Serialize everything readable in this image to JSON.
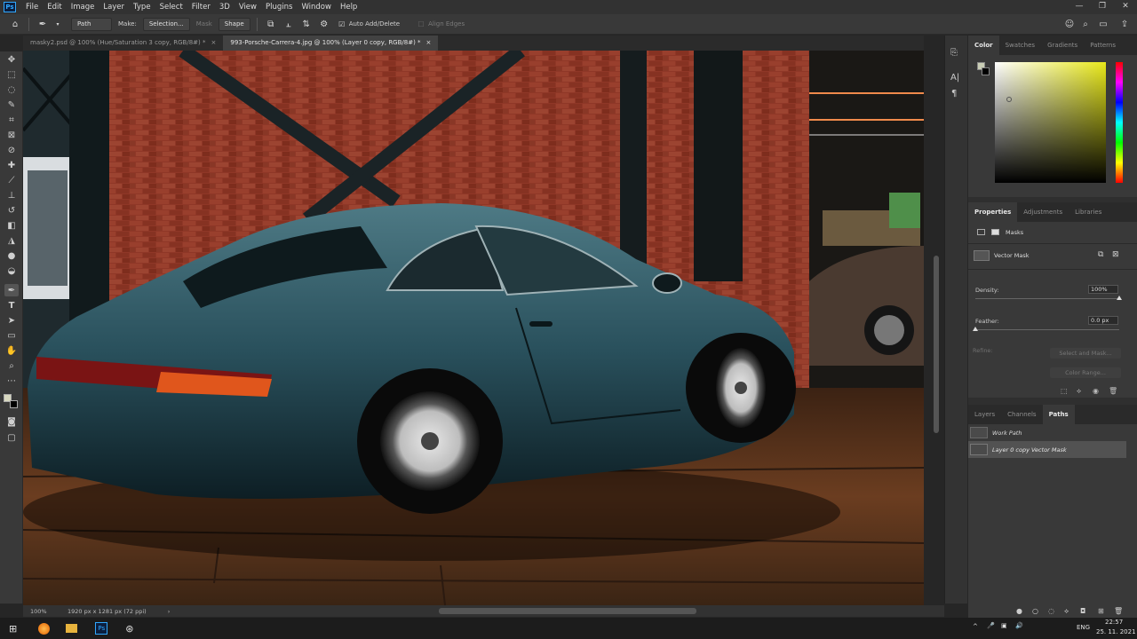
{
  "app": {
    "logo": "Ps"
  },
  "menubar": [
    "File",
    "Edit",
    "Image",
    "Layer",
    "Type",
    "Select",
    "Filter",
    "3D",
    "View",
    "Plugins",
    "Window",
    "Help"
  ],
  "options": {
    "tool_mode": "Path",
    "make_label": "Make:",
    "selection_button": "Selection...",
    "mask_button": "Mask",
    "shape_button": "Shape",
    "auto_add_delete": "Auto Add/Delete",
    "align_edges": "Align Edges"
  },
  "tabs": [
    {
      "label": "masky2.psd @ 100% (Hue/Saturation 3 copy, RGB/8#) *",
      "close": "×"
    },
    {
      "label": "993-Porsche-Carrera-4.jpg @ 100% (Layer 0 copy, RGB/8#) *",
      "close": "×"
    }
  ],
  "color_panel": {
    "tabs": [
      "Color",
      "Swatches",
      "Gradients",
      "Patterns"
    ],
    "hue_color": "#e8e81a"
  },
  "properties_panel": {
    "tabs": [
      "Properties",
      "Adjustments",
      "Libraries"
    ],
    "section": "Masks",
    "vector_mask": "Vector Mask",
    "density_label": "Density:",
    "density_value": "100%",
    "density_fraction": 1.0,
    "feather_label": "Feather:",
    "feather_value": "0.0 px",
    "feather_fraction": 0.0,
    "refine_label": "Refine:",
    "select_and_mask": "Select and Mask...",
    "color_range": "Color Range..."
  },
  "layers_panel": {
    "tabs": [
      "Layers",
      "Channels",
      "Paths"
    ],
    "paths": [
      "Work Path",
      "Layer 0 copy Vector Mask"
    ]
  },
  "status": {
    "zoom": "100%",
    "doc_info": "1920 px x 1281 px (72 ppi)"
  },
  "taskbar": {
    "lang": "ENG",
    "time": "22:57",
    "date": "25. 11. 2021"
  },
  "colors": {
    "accent": "#31a8ff",
    "panel": "#393939",
    "canvas_bg": "#262626"
  }
}
